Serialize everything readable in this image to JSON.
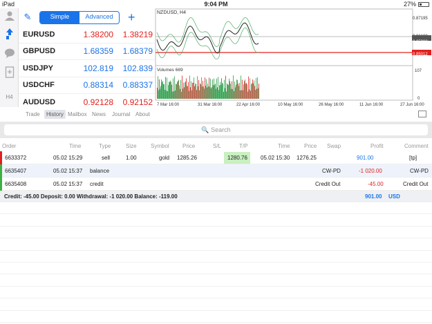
{
  "status": {
    "device": "iPad",
    "time": "9:04 PM",
    "battery": "27%"
  },
  "quotes": {
    "mode_simple": "Simple",
    "mode_advanced": "Advanced",
    "rows": [
      {
        "symbol": "EURUSD",
        "bid": "1.38200",
        "ask": "1.38219",
        "dir": "down"
      },
      {
        "symbol": "GBPUSD",
        "bid": "1.68359",
        "ask": "1.68379",
        "dir": "up"
      },
      {
        "symbol": "USDJPY",
        "bid": "102.819",
        "ask": "102.839",
        "dir": "up"
      },
      {
        "symbol": "USDCHF",
        "bid": "0.88314",
        "ask": "0.88337",
        "dir": "up"
      },
      {
        "symbol": "AUDUSD",
        "bid": "0.92128",
        "ask": "0.92152",
        "dir": "down"
      }
    ]
  },
  "rail": {
    "timeframe": "H4"
  },
  "chart": {
    "title": "NZDUSD, H4",
    "volumes_label": "Volumes 669",
    "price_labels": [
      "0.87195",
      "0.86180",
      "0.85983",
      "0.85012",
      "0.85012"
    ],
    "volume_axis": [
      "107",
      "0"
    ],
    "date_labels": [
      "7 Mar 16:00",
      "31 Mar 16:00",
      "22 Apr 16:00",
      "10 May 16:00",
      "26 May 16:00",
      "11 Jun 16:00",
      "27 Jun 16:00"
    ],
    "line_color": "#e0201e"
  },
  "tabs": [
    "Trade",
    "History",
    "Mailbox",
    "News",
    "Journal",
    "About"
  ],
  "active_tab": "History",
  "search": {
    "placeholder": "Search"
  },
  "table": {
    "headers": [
      "Order",
      "Time",
      "Type",
      "Size",
      "Symbol",
      "Price",
      "S/L",
      "T/P",
      "Time",
      "Price",
      "Swap",
      "Profit",
      "Comment"
    ],
    "rows": [
      {
        "order": "6633372",
        "time": "05.02 15:29",
        "type": "sell",
        "size": "1.00",
        "symbol": "gold",
        "price": "1285.26",
        "sl": "",
        "tp": "1280.76",
        "time2": "05.02 15:30",
        "price2": "1276.25",
        "swap": "",
        "profit": "901.00",
        "comment": "[tp]",
        "marker": "#e0201e"
      },
      {
        "order": "6635407",
        "time": "05.02 15:37",
        "type": "balance",
        "size": "",
        "symbol": "",
        "price": "",
        "sl": "",
        "tp": "",
        "time2": "",
        "price2": "",
        "swap": "CW-PD",
        "profit": "-1 020.00",
        "comment": "CW-PD",
        "marker": "#3cb043"
      },
      {
        "order": "6635408",
        "time": "05.02 15:37",
        "type": "credit",
        "size": "",
        "symbol": "",
        "price": "",
        "sl": "",
        "tp": "",
        "time2": "",
        "price2": "",
        "swap": "Credit Out",
        "profit": "-45.00",
        "comment": "Credit Out",
        "marker": "#3cb043"
      }
    ],
    "summary": "Credit: -45.00 Deposit: 0.00 Withdrawal: -1 020.00 Balance: -119.00",
    "total_profit": "901.00",
    "currency": "USD"
  }
}
